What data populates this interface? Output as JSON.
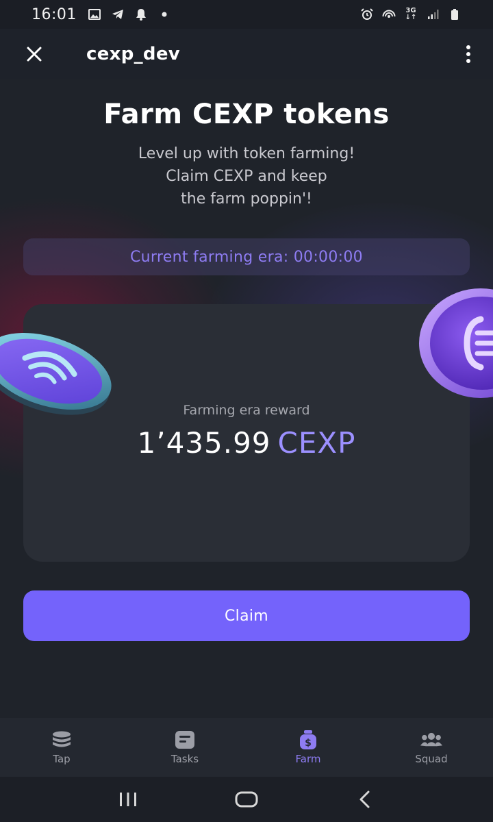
{
  "status_bar": {
    "time": "16:01",
    "network_label_top": "3G",
    "network_label_bottom": "↓↑"
  },
  "header": {
    "title": "cexp_dev"
  },
  "farm": {
    "title": "Farm CEXP tokens",
    "subtitle_lines": [
      "Level up with token farming!",
      "Claim CEXP and keep",
      "the farm poppin'!"
    ],
    "era_label": "Current farming era:",
    "era_timer": "00:00:00",
    "reward_label": "Farming era reward",
    "reward_amount": "1’435.99",
    "reward_unit": "CEXP",
    "claim_label": "Claim"
  },
  "bottom_nav": {
    "items": [
      {
        "label": "Tap",
        "icon": "coins-stack-icon",
        "active": false
      },
      {
        "label": "Tasks",
        "icon": "task-list-icon",
        "active": false
      },
      {
        "label": "Farm",
        "icon": "money-bag-icon",
        "active": true
      },
      {
        "label": "Squad",
        "icon": "group-icon",
        "active": false
      }
    ]
  },
  "colors": {
    "accent": "#7463fb",
    "accent_text": "#8e7cf2",
    "background": "#1f232a",
    "card": "#2a2e36"
  }
}
